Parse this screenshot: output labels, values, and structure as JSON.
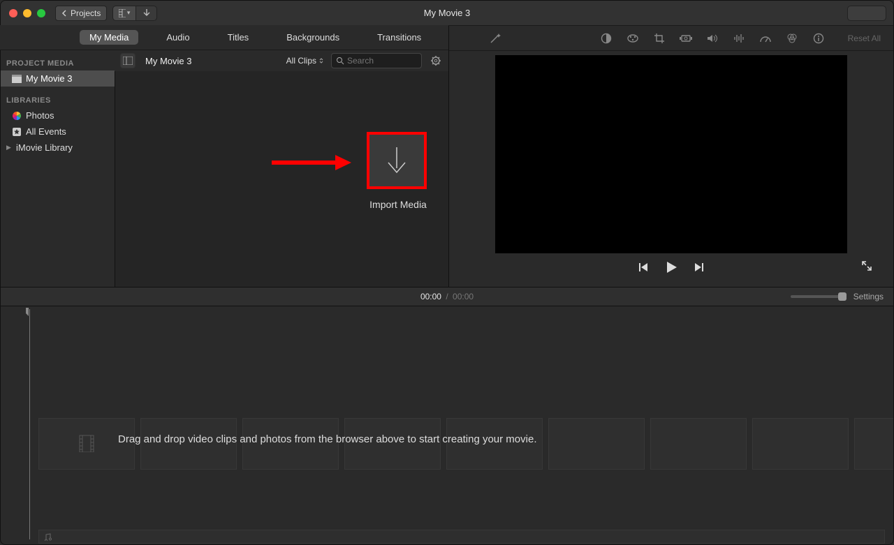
{
  "titlebar": {
    "back_label": "Projects",
    "title": "My Movie 3"
  },
  "tabs": {
    "my_media": "My Media",
    "audio": "Audio",
    "titles": "Titles",
    "backgrounds": "Backgrounds",
    "transitions": "Transitions"
  },
  "sidebar": {
    "section1": "PROJECT MEDIA",
    "project_name": "My Movie 3",
    "section2": "LIBRARIES",
    "photos": "Photos",
    "all_events": "All Events",
    "imovie_library": "iMovie Library"
  },
  "browser": {
    "title": "My Movie 3",
    "filter": "All Clips",
    "search_placeholder": "Search",
    "import_label": "Import Media"
  },
  "adjust": {
    "reset": "Reset All"
  },
  "timeline": {
    "current": "00:00",
    "duration": "00:00",
    "settings": "Settings",
    "hint": "Drag and drop video clips and photos from the browser above to start creating your movie."
  }
}
